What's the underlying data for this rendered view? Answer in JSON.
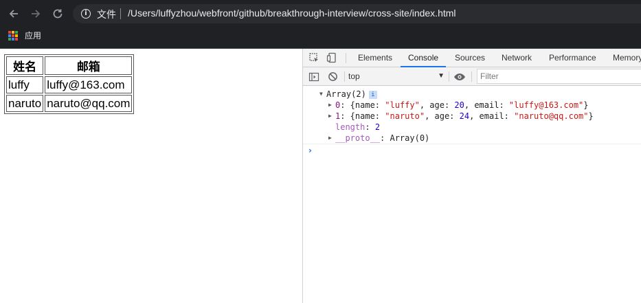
{
  "browser": {
    "file_label": "文件",
    "url": "/Users/luffyzhou/webfront/github/breakthrough-interview/cross-site/index.html",
    "bookmark_apps_label": "应用"
  },
  "page_table": {
    "headers": [
      "姓名",
      "邮箱"
    ],
    "rows": [
      [
        "luffy",
        "luffy@163.com"
      ],
      [
        "naruto",
        "naruto@qq.com"
      ]
    ]
  },
  "devtools": {
    "tabs": [
      "Elements",
      "Console",
      "Sources",
      "Network",
      "Performance",
      "Memory"
    ],
    "active_tab": "Console",
    "context": "top",
    "filter_placeholder": "Filter",
    "console": {
      "array_label": "Array(2)",
      "badge": "i",
      "item0": {
        "index": "0",
        "name": "\"luffy\"",
        "age": "20",
        "email": "\"luffy@163.com\""
      },
      "item1": {
        "index": "1",
        "name": "\"naruto\"",
        "age": "24",
        "email": "\"naruto@qq.com\""
      },
      "length_key": "length",
      "length_value": "2",
      "proto_key": "__proto__",
      "proto_value": "Array(0)",
      "prompt": "›"
    }
  },
  "colors": {
    "chrome_dark": "#202124",
    "active_tab_underline": "#1a73e8",
    "string": "#c41a16",
    "number": "#1c00cf",
    "property": "#881280"
  }
}
